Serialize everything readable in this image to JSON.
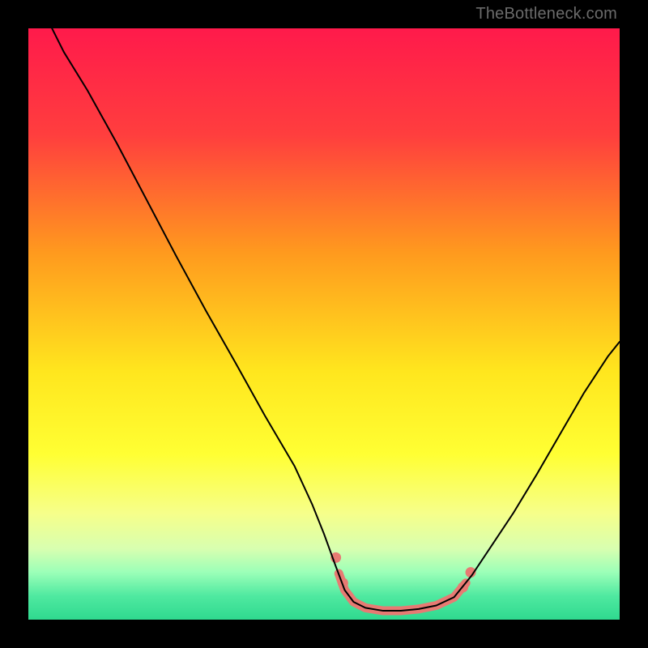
{
  "watermark": "TheBottleneck.com",
  "chart_data": {
    "type": "line",
    "title": "",
    "xlabel": "",
    "ylabel": "",
    "xlim": [
      0,
      100
    ],
    "ylim": [
      0,
      100
    ],
    "gradient_stops": [
      {
        "offset": 0,
        "color": "#ff1a4b"
      },
      {
        "offset": 18,
        "color": "#ff3e3e"
      },
      {
        "offset": 38,
        "color": "#ff9a1e"
      },
      {
        "offset": 58,
        "color": "#ffe61e"
      },
      {
        "offset": 72,
        "color": "#ffff33"
      },
      {
        "offset": 82,
        "color": "#f6ff8a"
      },
      {
        "offset": 88,
        "color": "#d8ffb0"
      },
      {
        "offset": 92,
        "color": "#9bffb8"
      },
      {
        "offset": 96,
        "color": "#4fe9a0"
      },
      {
        "offset": 100,
        "color": "#2fd98f"
      }
    ],
    "series": [
      {
        "name": "bottleneck-curve",
        "color": "#000000",
        "width": 2,
        "points": [
          {
            "x": 4.0,
            "y": 100.0
          },
          {
            "x": 6.0,
            "y": 96.0
          },
          {
            "x": 10.0,
            "y": 89.5
          },
          {
            "x": 15.0,
            "y": 80.5
          },
          {
            "x": 20.0,
            "y": 71.0
          },
          {
            "x": 25.0,
            "y": 61.5
          },
          {
            "x": 30.0,
            "y": 52.3
          },
          {
            "x": 35.0,
            "y": 43.5
          },
          {
            "x": 40.0,
            "y": 34.5
          },
          {
            "x": 45.0,
            "y": 26.0
          },
          {
            "x": 48.0,
            "y": 19.5
          },
          {
            "x": 50.0,
            "y": 14.5
          },
          {
            "x": 52.0,
            "y": 9.0
          },
          {
            "x": 53.5,
            "y": 5.0
          },
          {
            "x": 55.0,
            "y": 3.0
          },
          {
            "x": 57.0,
            "y": 2.0
          },
          {
            "x": 60.0,
            "y": 1.5
          },
          {
            "x": 63.0,
            "y": 1.5
          },
          {
            "x": 66.0,
            "y": 1.8
          },
          {
            "x": 69.0,
            "y": 2.4
          },
          {
            "x": 72.0,
            "y": 3.8
          },
          {
            "x": 75.0,
            "y": 7.5
          },
          {
            "x": 78.0,
            "y": 12.0
          },
          {
            "x": 82.0,
            "y": 18.0
          },
          {
            "x": 86.0,
            "y": 24.6
          },
          {
            "x": 90.0,
            "y": 31.5
          },
          {
            "x": 94.0,
            "y": 38.4
          },
          {
            "x": 98.0,
            "y": 44.5
          },
          {
            "x": 100.0,
            "y": 47.0
          }
        ]
      },
      {
        "name": "highlight-band",
        "color": "#e77a73",
        "width": 11,
        "points": [
          {
            "x": 52.5,
            "y": 7.8
          },
          {
            "x": 53.5,
            "y": 5.0
          },
          {
            "x": 55.0,
            "y": 3.0
          },
          {
            "x": 57.0,
            "y": 2.0
          },
          {
            "x": 60.0,
            "y": 1.5
          },
          {
            "x": 63.0,
            "y": 1.5
          },
          {
            "x": 66.0,
            "y": 1.8
          },
          {
            "x": 69.0,
            "y": 2.4
          },
          {
            "x": 72.0,
            "y": 3.8
          },
          {
            "x": 74.0,
            "y": 6.2
          }
        ]
      },
      {
        "name": "highlight-dot-1",
        "type_hint": "marker",
        "color": "#e77a73",
        "radius": 6.5,
        "x": 52.0,
        "y": 10.5
      },
      {
        "name": "highlight-dot-2",
        "type_hint": "marker",
        "color": "#e77a73",
        "radius": 6.5,
        "x": 53.2,
        "y": 6.2
      },
      {
        "name": "highlight-dot-3",
        "type_hint": "marker",
        "color": "#e77a73",
        "radius": 6.5,
        "x": 73.5,
        "y": 5.5
      },
      {
        "name": "highlight-dot-4",
        "type_hint": "marker",
        "color": "#e77a73",
        "radius": 6.5,
        "x": 74.8,
        "y": 8.0
      }
    ]
  }
}
